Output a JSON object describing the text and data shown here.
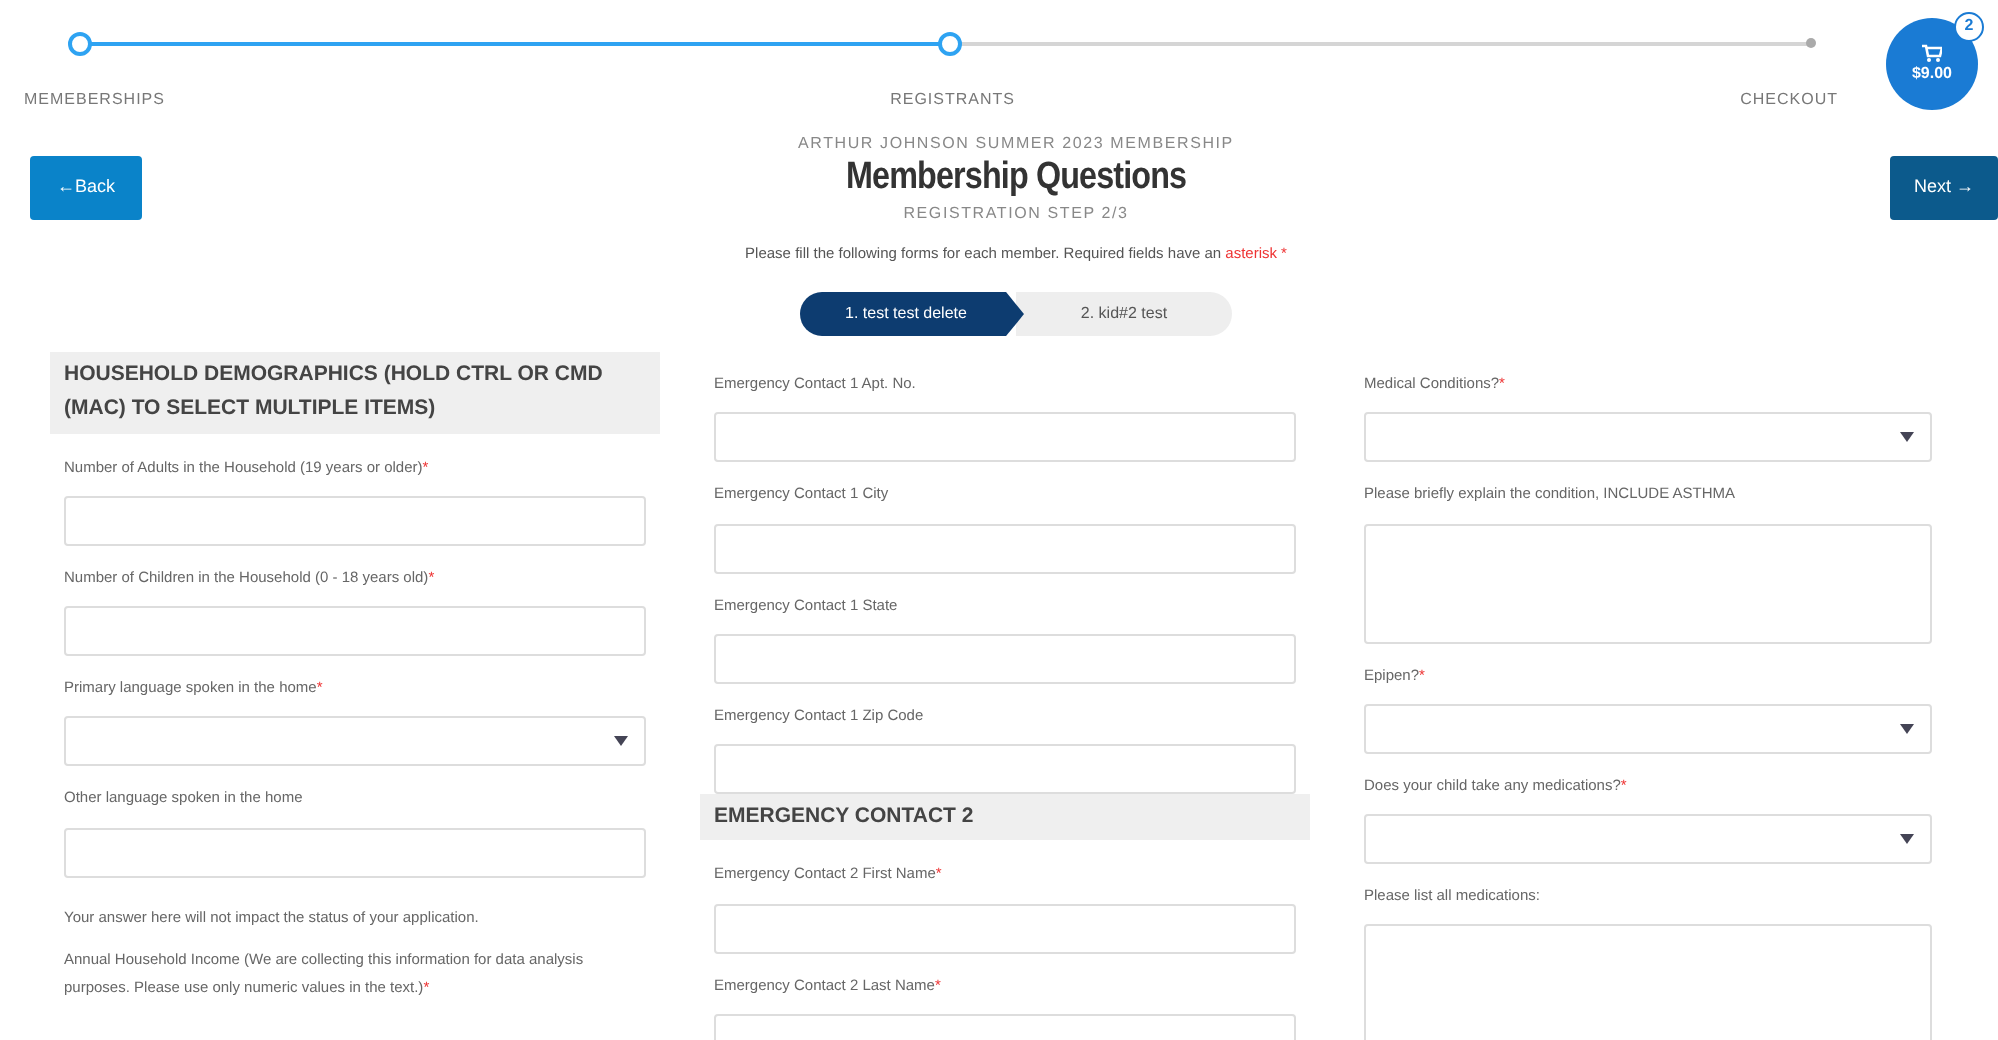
{
  "steps": [
    {
      "label": "MEMEBERSHIPS",
      "reached": true
    },
    {
      "label": "REGISTRANTS",
      "reached": true
    },
    {
      "label": "CHECKOUT",
      "reached": false
    }
  ],
  "cart": {
    "count": "2",
    "total": "$9.00"
  },
  "header": {
    "back": "←Back",
    "next": "Next →",
    "event": "ARTHUR JOHNSON SUMMER 2023 MEMBERSHIP",
    "title": "Membership Questions",
    "step": "REGISTRATION STEP 2/3",
    "instruction": "Please fill the following forms for each member. Required fields have an ",
    "asterisk": "asterisk",
    "star": "*"
  },
  "members": [
    {
      "label": "1. test test delete",
      "selected": true
    },
    {
      "label": "2. kid#2 test",
      "selected": false
    }
  ],
  "columns": [
    [
      {
        "kind": "heading",
        "text": "HOUSEHOLD DEMOGRAPHICS (HOLD CTRL OR CMD (MAC) TO SELECT MULTIPLE ITEMS)"
      },
      {
        "kind": "label",
        "text": "Number of Adults in the Household (19 years or older)",
        "required": true
      },
      {
        "kind": "input"
      },
      {
        "kind": "label",
        "text": "Number of Children in the Household (0 - 18 years old)",
        "required": true
      },
      {
        "kind": "input"
      },
      {
        "kind": "label",
        "text": "Primary language spoken in the home",
        "required": true
      },
      {
        "kind": "select"
      },
      {
        "kind": "label",
        "text": "Other language spoken in the home",
        "required": false
      },
      {
        "kind": "input"
      },
      {
        "kind": "note",
        "text": "Your answer here will not impact the status of your application."
      },
      {
        "kind": "label",
        "text": "Annual Household Income (We are collecting this information for data analysis purposes. Please use only numeric values in the text.)",
        "required": true
      }
    ],
    [
      {
        "kind": "label",
        "text": "Emergency Contact 1 Apt. No.",
        "required": false
      },
      {
        "kind": "input"
      },
      {
        "kind": "label",
        "text": "Emergency Contact 1 City",
        "required": false
      },
      {
        "kind": "input"
      },
      {
        "kind": "label",
        "text": "Emergency Contact 1 State",
        "required": false
      },
      {
        "kind": "input"
      },
      {
        "kind": "label",
        "text": "Emergency Contact 1 Zip Code",
        "required": false
      },
      {
        "kind": "input"
      },
      {
        "kind": "heading",
        "text": "EMERGENCY CONTACT 2"
      },
      {
        "kind": "label",
        "text": "Emergency Contact 2 First Name",
        "required": true
      },
      {
        "kind": "input"
      },
      {
        "kind": "label",
        "text": "Emergency Contact 2 Last Name",
        "required": true
      },
      {
        "kind": "input"
      }
    ],
    [
      {
        "kind": "label",
        "text": "Medical Conditions?",
        "required": true
      },
      {
        "kind": "select"
      },
      {
        "kind": "label",
        "text": "Please briefly explain the condition, INCLUDE ASTHMA",
        "required": false
      },
      {
        "kind": "textarea"
      },
      {
        "kind": "label",
        "text": "Epipen?",
        "required": true
      },
      {
        "kind": "select"
      },
      {
        "kind": "label",
        "text": "Does your child take any medications?",
        "required": true
      },
      {
        "kind": "select"
      },
      {
        "kind": "label",
        "text": "Please list all medications:",
        "required": false
      },
      {
        "kind": "textarea"
      }
    ]
  ]
}
